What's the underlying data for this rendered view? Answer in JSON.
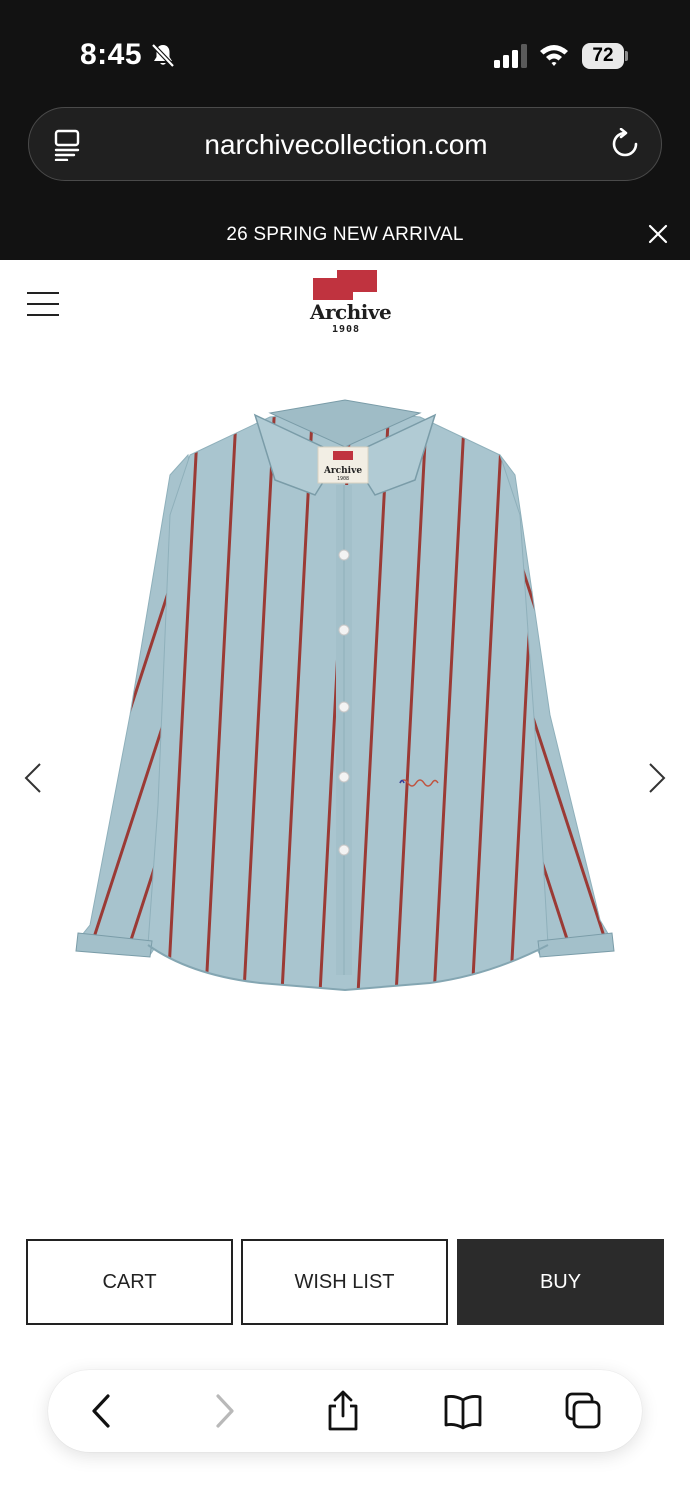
{
  "status_bar": {
    "time": "8:45",
    "battery": "72",
    "icons": [
      "bell-slash-icon",
      "signal-icon",
      "wifi-icon",
      "battery-icon"
    ]
  },
  "browser": {
    "url": "narchivecollection.com",
    "icons": [
      "reader-icon",
      "reload-icon"
    ]
  },
  "banner": {
    "text": "26 SPRING NEW ARRIVAL",
    "close_icon": "close-icon"
  },
  "header": {
    "menu_icon": "hamburger-menu-icon",
    "logo": {
      "word": "Archive",
      "year": "1908"
    }
  },
  "product": {
    "image_alt": "blue-red-striped-shirt",
    "label_word": "Archive",
    "label_year": "1908"
  },
  "actions": {
    "cart": "CART",
    "wishlist": "WISH LIST",
    "buy": "BUY"
  },
  "toolbar": {
    "icons": [
      "back-icon",
      "forward-icon",
      "share-icon",
      "bookmarks-icon",
      "tabs-icon"
    ]
  },
  "colors": {
    "dark": "#121212",
    "buy_button": "#2b2b2b",
    "logo_red": "#c0333f",
    "shirt_blue": "#a9c5cf",
    "stripe_red": "#9b3a35"
  }
}
